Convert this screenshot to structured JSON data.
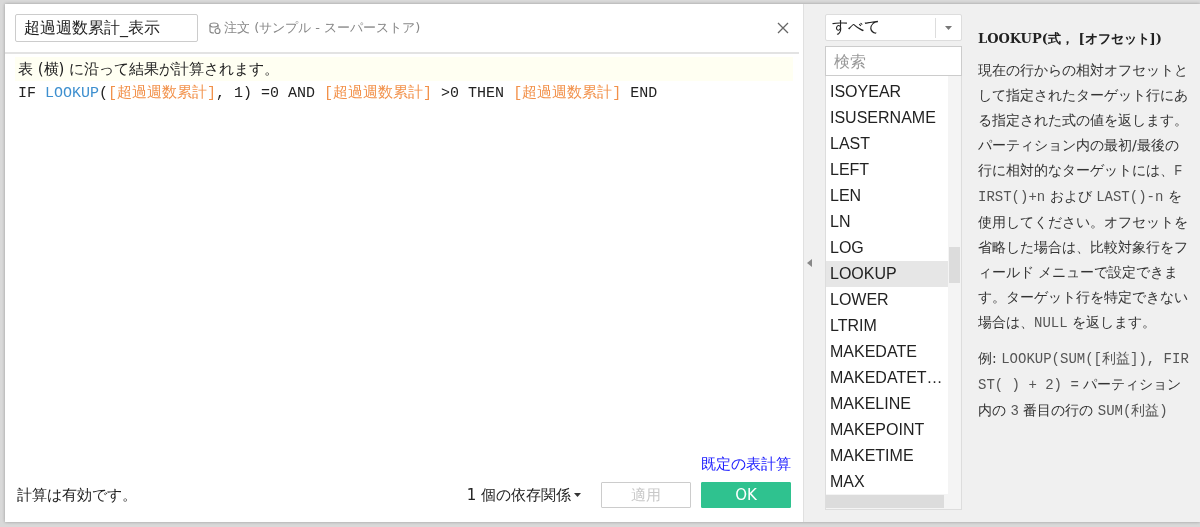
{
  "calc_name": "超過週数累計_表示",
  "data_source": "注文 (サンプル - スーパーストア)",
  "hint": "表 (横) に沿って結果が計算されます。",
  "formula": [
    {
      "kind": "keyword",
      "text": "IF "
    },
    {
      "kind": "function",
      "text": "LOOKUP"
    },
    {
      "kind": "plain",
      "text": "("
    },
    {
      "kind": "field",
      "text": "[超過週数累計]"
    },
    {
      "kind": "plain",
      "text": ", 1) =0 AND "
    },
    {
      "kind": "field",
      "text": "[超過週数累計]"
    },
    {
      "kind": "plain",
      "text": " >0 THEN "
    },
    {
      "kind": "field",
      "text": "[超過週数累計]"
    },
    {
      "kind": "plain",
      "text": " END"
    }
  ],
  "default_table_calc_link": "既定の表計算",
  "status": "計算は有効です。",
  "dependencies": "1 個の依存関係",
  "buttons": [
    {
      "label": "適用",
      "disabled": true
    },
    {
      "label": "OK",
      "disabled": false
    }
  ],
  "category": "すべて",
  "search": {
    "placeholder": "検索"
  },
  "functions": [
    {
      "name": "ISOYEAR",
      "selected": false
    },
    {
      "name": "ISUSERNAME",
      "selected": false
    },
    {
      "name": "LAST",
      "selected": false
    },
    {
      "name": "LEFT",
      "selected": false
    },
    {
      "name": "LEN",
      "selected": false
    },
    {
      "name": "LN",
      "selected": false
    },
    {
      "name": "LOG",
      "selected": false
    },
    {
      "name": "LOOKUP",
      "selected": true
    },
    {
      "name": "LOWER",
      "selected": false
    },
    {
      "name": "LTRIM",
      "selected": false
    },
    {
      "name": "MAKEDATE",
      "selected": false
    },
    {
      "name": "MAKEDATET…",
      "selected": false
    },
    {
      "name": "MAKELINE",
      "selected": false
    },
    {
      "name": "MAKEPOINT",
      "selected": false
    },
    {
      "name": "MAKETIME",
      "selected": false
    },
    {
      "name": "MAX",
      "selected": false
    }
  ],
  "help": {
    "title": "LOOKUP(式， [オフセット])",
    "paragraphs": [
      [
        {
          "kind": "text",
          "text": "現在の行からの相対オフセットとして指定されたターゲット行にある指定された式の値を返します。パーティション内の最初/最後の行に相対的なターゲットには、"
        },
        {
          "kind": "code",
          "text": "FIRST()+n"
        },
        {
          "kind": "text",
          "text": " および "
        },
        {
          "kind": "code",
          "text": "LAST()-n"
        },
        {
          "kind": "text",
          "text": " を使用してください。オフセットを省略した場合は、比較対象行をフィールド メニューで設定できます。ターゲット行を特定できない場合は、"
        },
        {
          "kind": "code",
          "text": "NULL"
        },
        {
          "kind": "text",
          "text": " を返します。"
        }
      ],
      [
        {
          "kind": "text",
          "text": "例: "
        },
        {
          "kind": "code",
          "text": "LOOKUP(SUM([利益]), FIRST( ) + 2) ="
        },
        {
          "kind": "text",
          "text": " パーティション内の "
        },
        {
          "kind": "code",
          "text": "3"
        },
        {
          "kind": "text",
          "text": " 番目の行の "
        },
        {
          "kind": "code",
          "text": "SUM(利益)"
        }
      ]
    ]
  }
}
